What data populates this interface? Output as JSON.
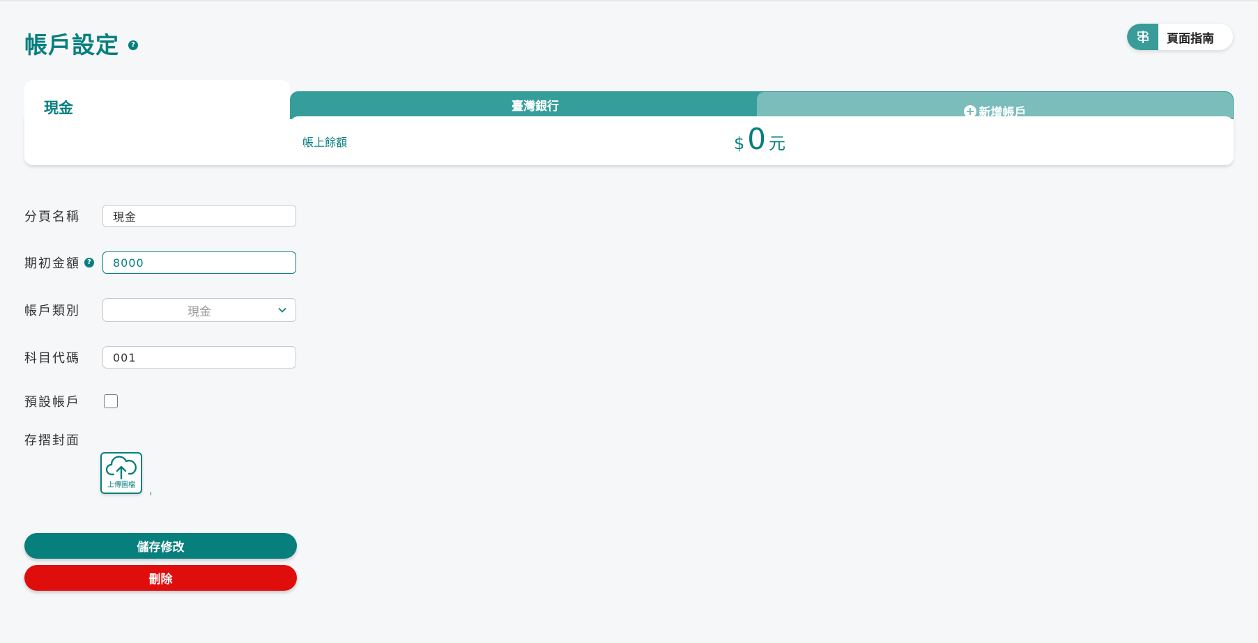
{
  "header": {
    "title": "帳戶設定",
    "help_icon": "question-circle-icon",
    "guide_label": "頁面指南",
    "guide_icon": "signpost-icon"
  },
  "tabs": {
    "active": "現金",
    "bank": "臺灣銀行",
    "add": "新增帳戶",
    "add_icon": "plus-circle-icon"
  },
  "balance": {
    "label": "帳上餘額",
    "currency": "$",
    "value": "0",
    "unit": "元"
  },
  "form": {
    "tab_name_label": "分頁名稱",
    "tab_name_value": "現金",
    "initial_amount_label": "期初金額",
    "initial_amount_value": "8000",
    "account_type_label": "帳戶類別",
    "account_type_value": "現金",
    "subject_code_label": "科目代碼",
    "subject_code_value": "001",
    "default_account_label": "預設帳戶",
    "default_account_checked": false,
    "passbook_cover_label": "存摺封面",
    "upload_label": "上傳圖檔",
    "upload_icon": "cloud-upload-icon"
  },
  "actions": {
    "save_label": "儲存修改",
    "delete_label": "刪除"
  },
  "colors": {
    "primary": "#067f7d",
    "tab_bank": "#359e9b",
    "tab_add": "#7bbdbb",
    "danger": "#e00d0d",
    "background": "#f6f7f9"
  }
}
